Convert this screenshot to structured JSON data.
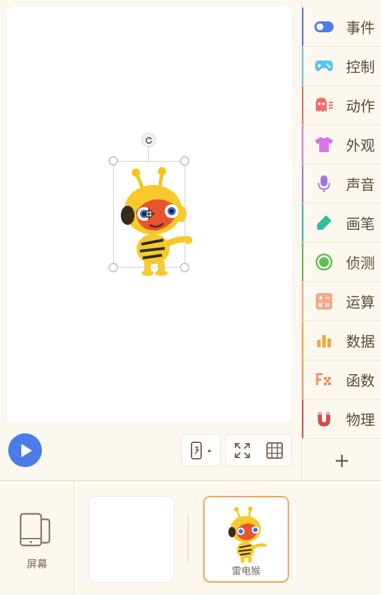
{
  "stage": {
    "sprite_name": "雷电猴"
  },
  "toolbar": {
    "play": "play",
    "device": "device-select",
    "fullscreen": "fullscreen",
    "grid": "grid"
  },
  "categories": [
    {
      "label": "事件",
      "icon": "toggle-icon",
      "color": "#4b7de8"
    },
    {
      "label": "控制",
      "icon": "gamepad-icon",
      "color": "#5cc4f0"
    },
    {
      "label": "动作",
      "icon": "ghost-icon",
      "color": "#f06a6a"
    },
    {
      "label": "外观",
      "icon": "shirt-icon",
      "color": "#d774e8"
    },
    {
      "label": "声音",
      "icon": "microphone-icon",
      "color": "#a571e8"
    },
    {
      "label": "画笔",
      "icon": "pen-icon",
      "color": "#2fbf9e"
    },
    {
      "label": "侦测",
      "icon": "radar-icon",
      "color": "#5bc04e"
    },
    {
      "label": "运算",
      "icon": "calculator-icon",
      "color": "#f3a98a"
    },
    {
      "label": "数据",
      "icon": "bar-chart-icon",
      "color": "#f3a53a"
    },
    {
      "label": "函数",
      "icon": "function-icon",
      "color": "#f08f63"
    },
    {
      "label": "物理",
      "icon": "magnet-icon",
      "color": "#d64b4b"
    }
  ],
  "add_category": "+",
  "bottom": {
    "screen_label": "屏幕",
    "sprite_card_label": "雷电猴"
  }
}
